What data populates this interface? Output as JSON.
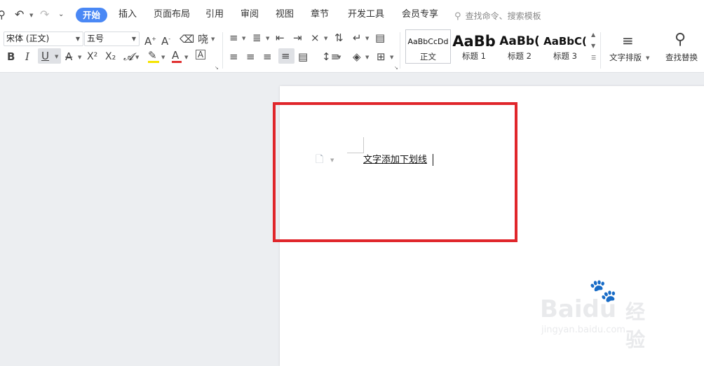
{
  "menu": {
    "tabs": [
      "开始",
      "插入",
      "页面布局",
      "引用",
      "审阅",
      "视图",
      "章节",
      "开发工具",
      "会员专享"
    ],
    "search_placeholder": "查找命令、搜索模板"
  },
  "font": {
    "name": "宋体 (正文)",
    "size": "五号"
  },
  "format_glyphs": {
    "bold": "B",
    "italic": "I",
    "underline": "U",
    "strike": "A",
    "superscript": "X²",
    "subscript": "X₂",
    "font_color": "A",
    "char_shade": "A"
  },
  "styles": [
    {
      "preview": "AaBbCcDd",
      "label": "正文"
    },
    {
      "preview": "AaBb",
      "label": "标题 1"
    },
    {
      "preview": "AaBb(",
      "label": "标题 2"
    },
    {
      "preview": "AaBbC(",
      "label": "标题 3"
    }
  ],
  "right_tools": {
    "text_layout": "文字排版",
    "find_replace": "查找替换"
  },
  "document": {
    "text": "文字添加下划线"
  },
  "colors": {
    "accent": "#4a88f5",
    "highlight_box": "#e0262b",
    "highlight_bar": "#f5e400",
    "font_color_bar": "#e03030"
  },
  "watermark": {
    "brand": "Baidu",
    "brand_cn": "经验",
    "url": "jingyan.baidu.com"
  }
}
